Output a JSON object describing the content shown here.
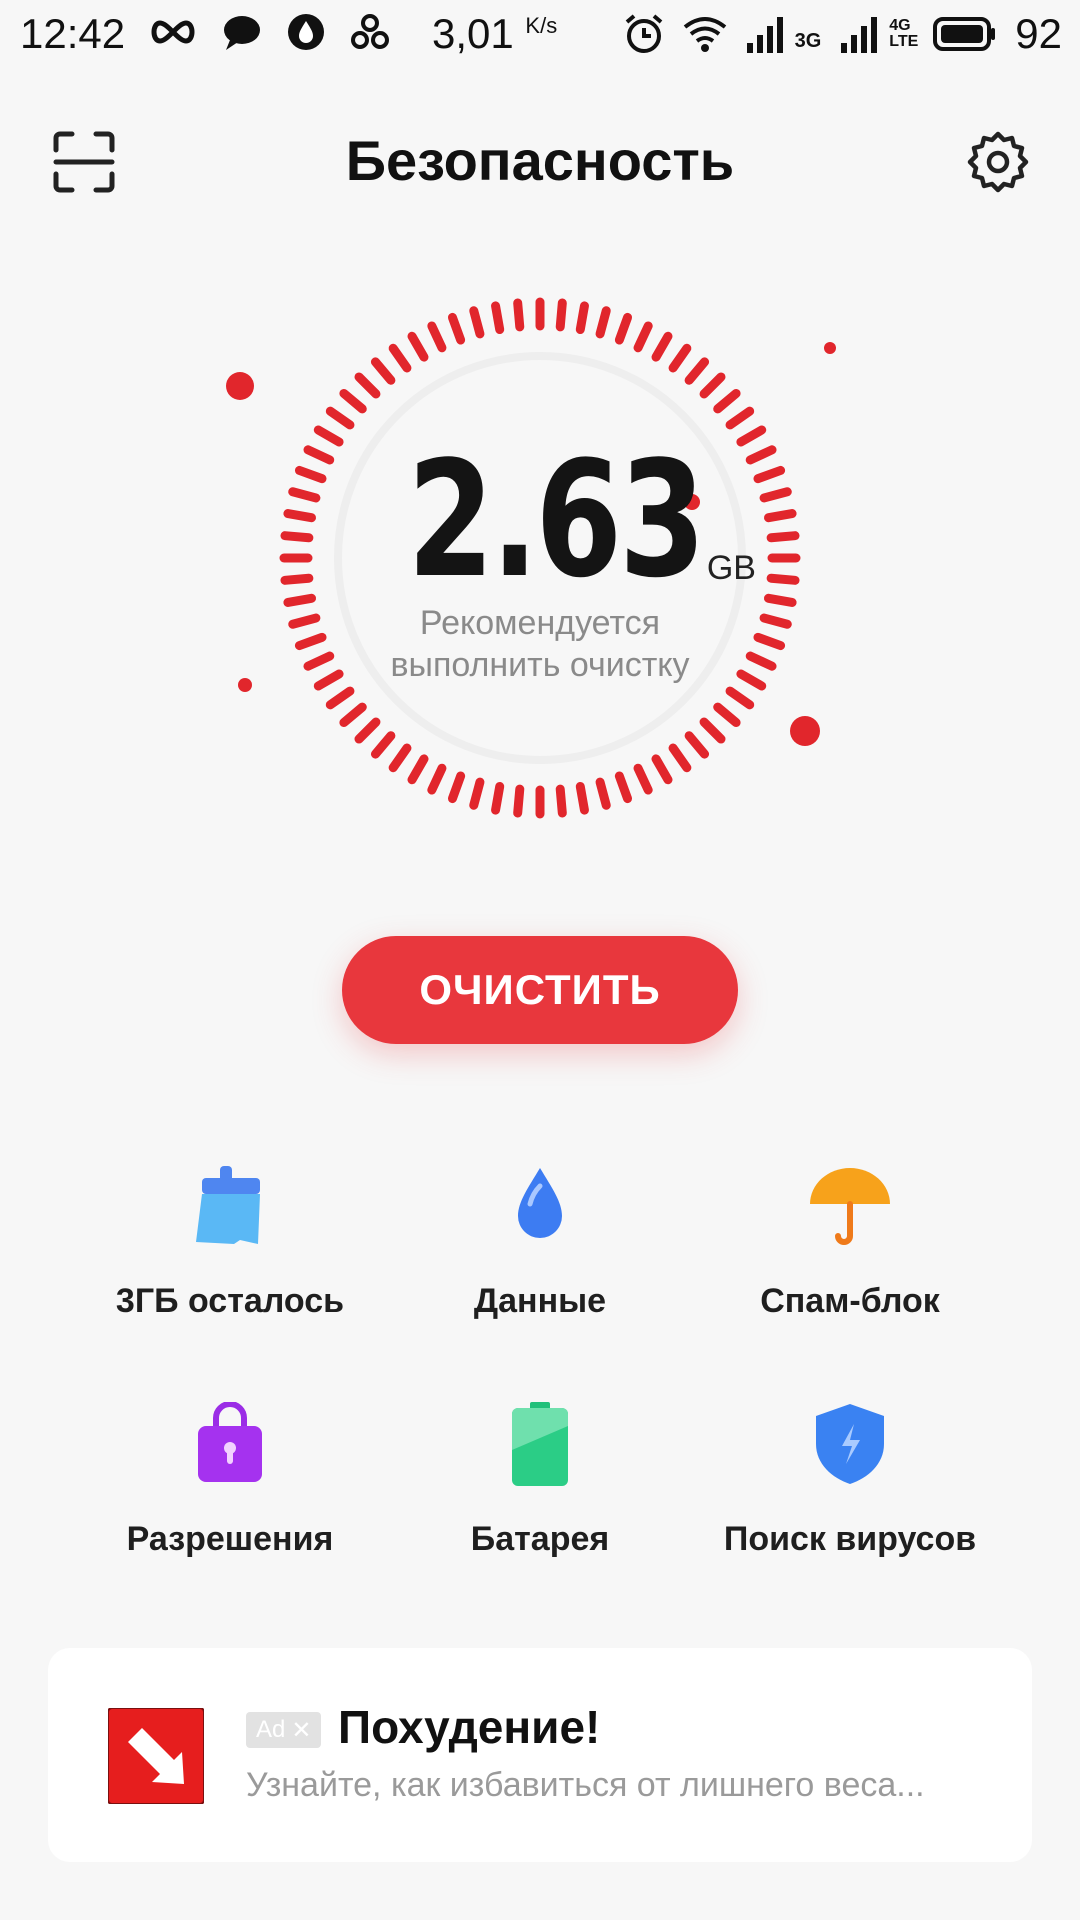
{
  "status_bar": {
    "time": "12:42",
    "speed_value": "3,01",
    "speed_unit": "K/s",
    "network_1": "3G",
    "network_2": "4G LTE",
    "battery_level": "92"
  },
  "header": {
    "title": "Безопасность",
    "scan_icon": "scan-icon",
    "settings_icon": "gear-icon"
  },
  "gauge": {
    "value": "2.63",
    "unit": "GB",
    "hint_line1": "Рекомендуется",
    "hint_line2": "выполнить очистку",
    "accent_color": "#e1262c"
  },
  "clean_button": {
    "label": "ОЧИСТИТЬ",
    "color": "#e8373d"
  },
  "features": [
    {
      "label": "3ГБ осталось",
      "icon": "broom-icon"
    },
    {
      "label": "Данные",
      "icon": "water-drop-icon"
    },
    {
      "label": "Спам-блок",
      "icon": "umbrella-icon"
    },
    {
      "label": "Разрешения",
      "icon": "lock-bag-icon"
    },
    {
      "label": "Батарея",
      "icon": "battery-icon"
    },
    {
      "label": "Поиск вирусов",
      "icon": "shield-icon"
    }
  ],
  "ad": {
    "badge": "Ad",
    "title": "Похудение!",
    "description": "Узнайте, как избавиться от лишнего веса..."
  }
}
